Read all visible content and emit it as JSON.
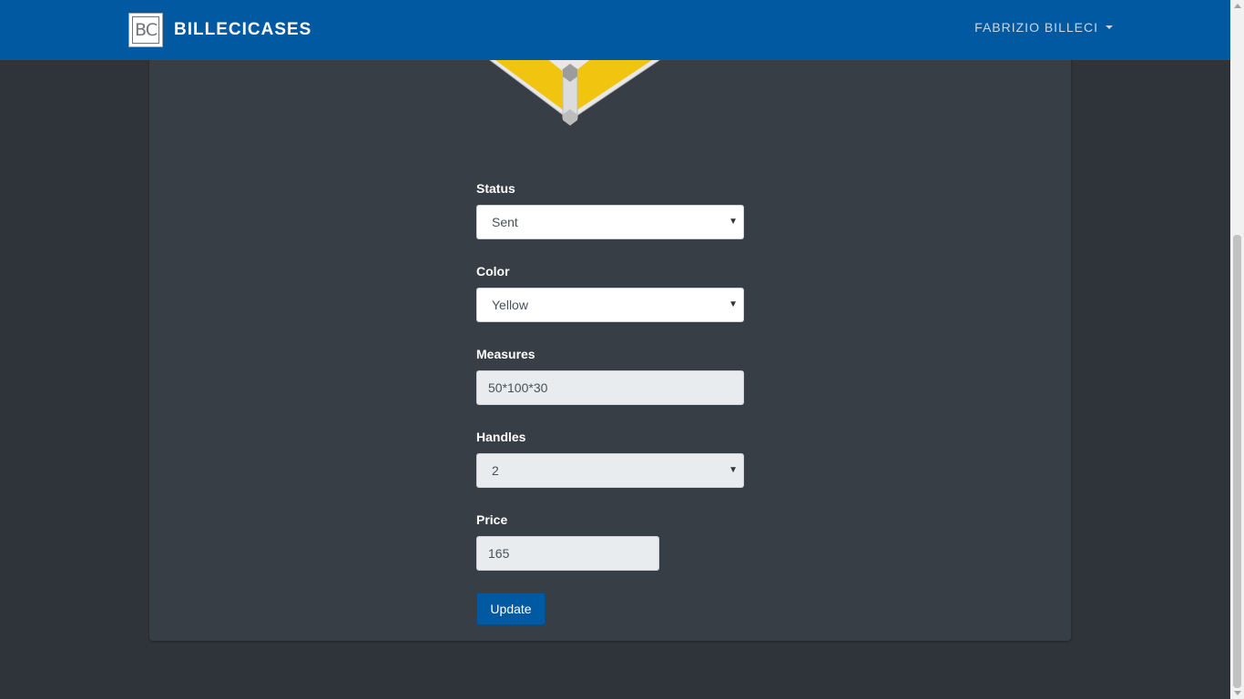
{
  "header": {
    "brand_logo_text": "BC",
    "brand_name": "BILLECICASES",
    "user_name": "FABRIZIO BILLECI",
    "background_color": "#0059a1"
  },
  "product_image": {
    "icon": "yellow-case-icon"
  },
  "form": {
    "status": {
      "label": "Status",
      "value": "Sent"
    },
    "color": {
      "label": "Color",
      "value": "Yellow"
    },
    "measures": {
      "label": "Measures",
      "value": "50*100*30"
    },
    "handles": {
      "label": "Handles",
      "value": "2"
    },
    "price": {
      "label": "Price",
      "value": "165"
    },
    "submit_label": "Update"
  },
  "colors": {
    "page_background": "#2f343a",
    "card_background": "#373e46",
    "accent": "#0059a1"
  }
}
